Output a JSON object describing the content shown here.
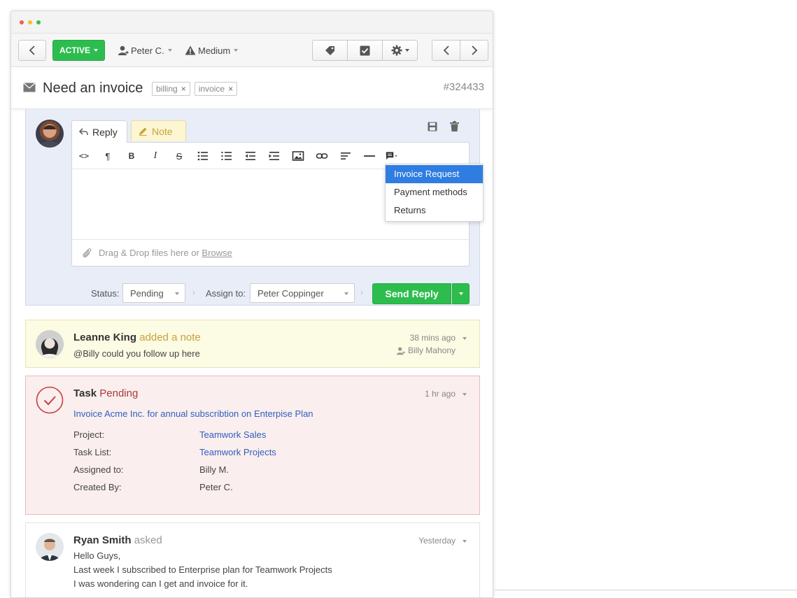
{
  "toolbar": {
    "status_label": "ACTIVE",
    "assignee_label": "Peter C.",
    "priority_label": "Medium"
  },
  "ticket": {
    "title": "Need an invoice",
    "tags": [
      "billing",
      "invoice"
    ],
    "number": "#324433"
  },
  "composer": {
    "tabs": {
      "reply": "Reply",
      "note": "Note"
    },
    "attach_text": "Drag & Drop files here or ",
    "attach_link": "Browse",
    "status_label": "Status:",
    "status_value": "Pending",
    "assign_label": "Assign to:",
    "assign_value": "Peter Coppinger",
    "send_label": "Send Reply"
  },
  "canned_menu": {
    "items": [
      "Invoice Request",
      "Payment methods",
      "Returns"
    ],
    "selected": "Invoice Request"
  },
  "note": {
    "author": "Leanne King",
    "action": "added a note",
    "body": "@Billy could you follow up here",
    "time": "38 mins ago",
    "assignee": "Billy Mahony"
  },
  "task": {
    "label": "Task",
    "status": "Pending",
    "time": "1 hr ago",
    "title": "Invoice Acme Inc. for annual subscribtion on Enterpise Plan",
    "fields": [
      {
        "label": "Project:",
        "value": "Teamwork Sales",
        "link": true
      },
      {
        "label": "Task List:",
        "value": "Teamwork Projects",
        "link": true
      },
      {
        "label": "Assigned to:",
        "value": "Billy M.",
        "link": false
      },
      {
        "label": "Created By:",
        "value": "Peter C.",
        "link": false
      }
    ]
  },
  "message": {
    "author": "Ryan Smith",
    "action": "asked",
    "time": "Yesterday",
    "lines": [
      "Hello Guys,",
      "Last week I subscribed to Enterprise plan for Teamwork Projects",
      "I was wondering can I get and invoice for it."
    ]
  },
  "colors": {
    "active_green": "#2dbd4e",
    "menu_highlight": "#2f7de1",
    "task_red": "#c74040",
    "note_gold": "#c8a23a",
    "link_blue": "#2f5fbf"
  }
}
